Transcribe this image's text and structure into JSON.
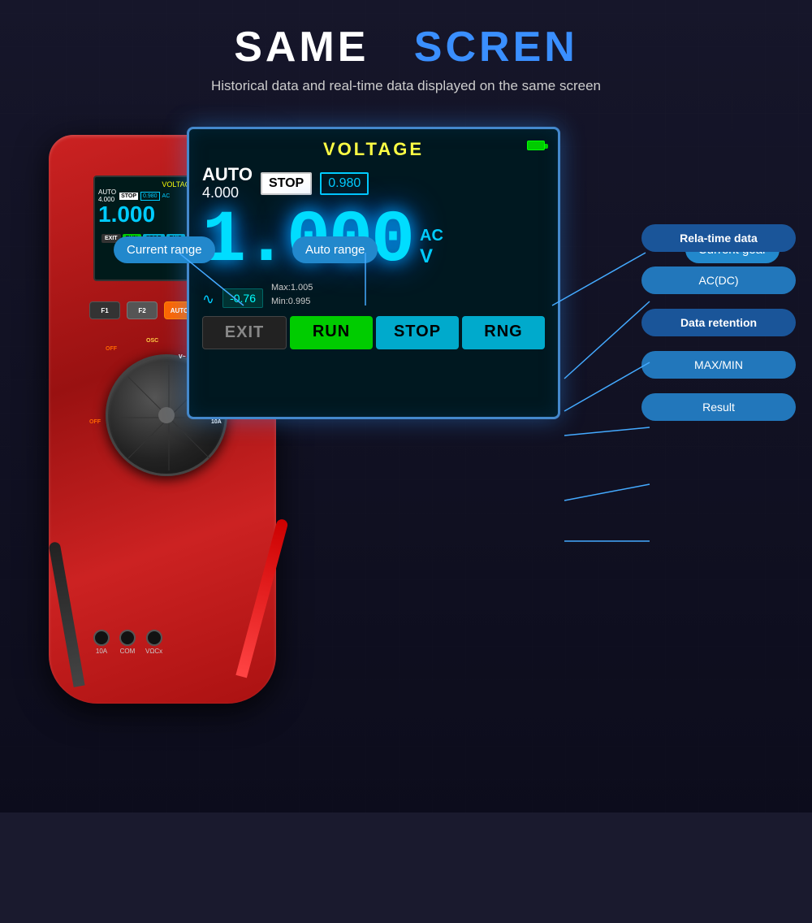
{
  "page": {
    "title_part1": "SAME",
    "title_part2": "SCREN",
    "subtitle": "Historical data and real-time data displayed on the same screen"
  },
  "annotations": {
    "current_range": "Current range",
    "auto_range": "Auto range",
    "current_gear": "Current gear",
    "realtime_data": "Rela-time data",
    "ac_dc": "AC(DC)",
    "data_retention": "Data retention",
    "max_min": "MAX/MIN",
    "result": "Result"
  },
  "screen": {
    "title": "VOLTAGE",
    "mode_label": "AUTO",
    "mode_value": "4.000",
    "stop_label": "STOP",
    "stop_value": "0.980",
    "main_value": "1.000",
    "ac_label": "AC",
    "v_label": "V",
    "graph_val": "-0.76",
    "max_val": "Max:1.005",
    "min_val": "Min:0.995",
    "btn_exit": "EXIT",
    "btn_run": "RUN",
    "btn_stop": "STOP",
    "btn_rng": "RNG"
  },
  "device": {
    "btn_f1": "F1",
    "btn_f2": "F2",
    "btn_auto": "AUTO",
    "port_10a": "10A",
    "port_com": "COM",
    "port_vocx": "VΩCx"
  }
}
